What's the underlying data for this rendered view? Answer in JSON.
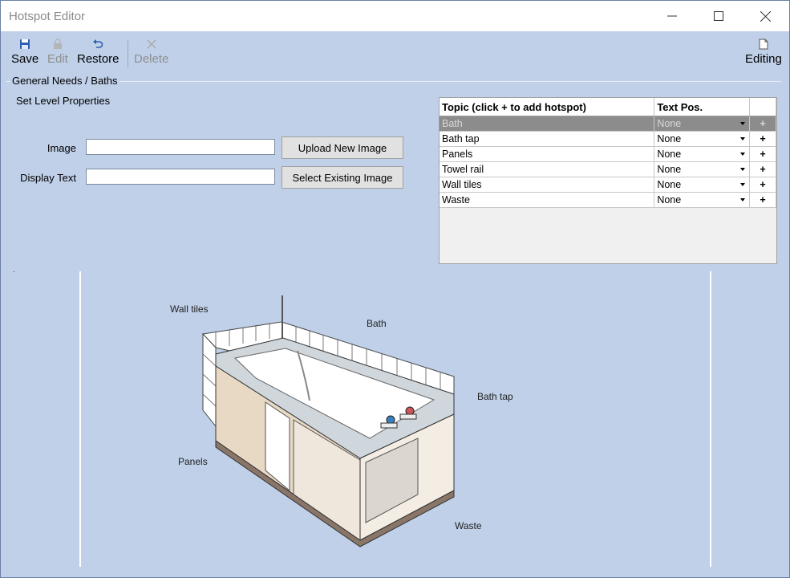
{
  "window": {
    "title": "Hotspot Editor"
  },
  "toolbar": {
    "save": "Save",
    "edit": "Edit",
    "restore": "Restore",
    "delete": "Delete",
    "editing": "Editing"
  },
  "group": {
    "label": "General Needs / Baths",
    "set_level": "Set Level Properties"
  },
  "form": {
    "image_label": "Image",
    "image_value": "",
    "display_label": "Display Text",
    "display_value": "",
    "upload_label": "Upload New Image",
    "select_label": "Select Existing Image"
  },
  "grid": {
    "col_topic": "Topic (click + to add hotspot)",
    "col_textpos": "Text Pos.",
    "rows": [
      {
        "topic": "Bath",
        "pos": "None",
        "plus": "+"
      },
      {
        "topic": "Bath tap",
        "pos": "None",
        "plus": "+"
      },
      {
        "topic": "Panels",
        "pos": "None",
        "plus": "+"
      },
      {
        "topic": "Towel rail",
        "pos": "None",
        "plus": "+"
      },
      {
        "topic": "Wall tiles",
        "pos": "None",
        "plus": "+"
      },
      {
        "topic": "Waste",
        "pos": "None",
        "plus": "+"
      }
    ]
  },
  "image": {
    "labels": {
      "wall_tiles": "Wall tiles",
      "bath": "Bath",
      "bath_tap": "Bath tap",
      "panels": "Panels",
      "waste": "Waste"
    }
  },
  "colors": {
    "bg": "#bfd0e8",
    "accent": "#2c5fb3",
    "selected_row": "#8c8c8c"
  }
}
